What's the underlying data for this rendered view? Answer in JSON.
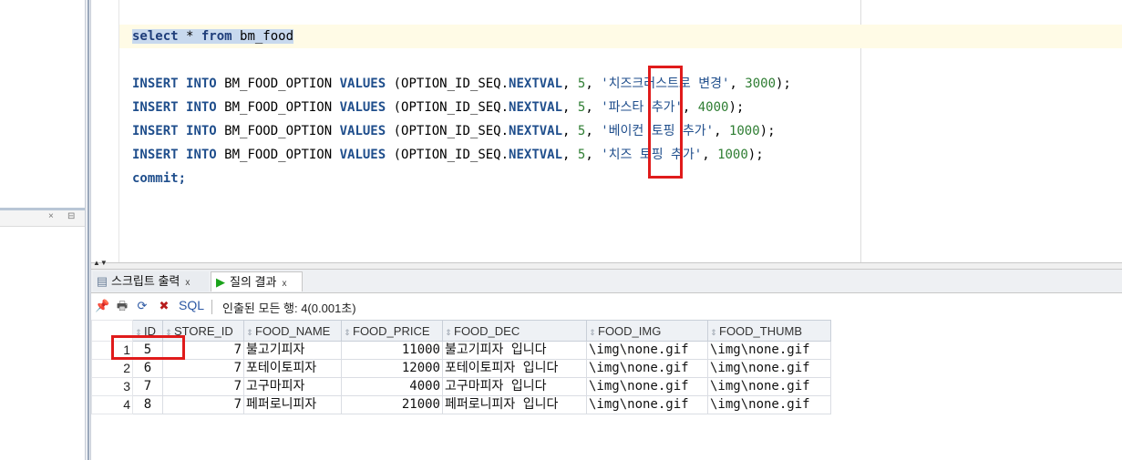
{
  "editor": {
    "select_line": [
      "select",
      " * ",
      "from",
      " bm_food"
    ],
    "insert_rows": [
      {
        "kw1": "INSERT",
        "kw2": "INTO",
        "table": " BM_FOOD_OPTION ",
        "kw3": "VALUES",
        "open": " (OPTION_ID_SEQ.",
        "nextval": "NEXTVAL",
        "sep": ", ",
        "id": "5",
        "comma": ", ",
        "str": "'치즈크러스트로 변경'",
        "sep2": ", ",
        "price": "3000",
        "end": ");"
      },
      {
        "kw1": "INSERT",
        "kw2": "INTO",
        "table": " BM_FOOD_OPTION ",
        "kw3": "VALUES",
        "open": " (OPTION_ID_SEQ.",
        "nextval": "NEXTVAL",
        "sep": ", ",
        "id": "5",
        "comma": ", ",
        "str": "'파스타 추가'",
        "sep2": ", ",
        "price": "4000",
        "end": ");"
      },
      {
        "kw1": "INSERT",
        "kw2": "INTO",
        "table": " BM_FOOD_OPTION ",
        "kw3": "VALUES",
        "open": " (OPTION_ID_SEQ.",
        "nextval": "NEXTVAL",
        "sep": ", ",
        "id": "5",
        "comma": ", ",
        "str": "'베이컨 토핑 추가'",
        "sep2": ", ",
        "price": "1000",
        "end": ");"
      },
      {
        "kw1": "INSERT",
        "kw2": "INTO",
        "table": " BM_FOOD_OPTION ",
        "kw3": "VALUES",
        "open": " (OPTION_ID_SEQ.",
        "nextval": "NEXTVAL",
        "sep": ", ",
        "id": "5",
        "comma": ", ",
        "str": "'치즈 토핑 추가'",
        "sep2": ", ",
        "price": "1000",
        "end": ");"
      }
    ],
    "commit_line": "commit;"
  },
  "tabs": [
    {
      "label": "스크립트 출력",
      "close": "x"
    },
    {
      "label": "질의 결과",
      "close": "x"
    }
  ],
  "results_toolbar": {
    "sql_label": "SQL",
    "status": "인출된 모든 행: 4(0.001초)"
  },
  "left_panel": {
    "close": "×",
    "minimize": "⊟"
  },
  "grid": {
    "columns": [
      "ID",
      "STORE_ID",
      "FOOD_NAME",
      "FOOD_PRICE",
      "FOOD_DEC",
      "FOOD_IMG",
      "FOOD_THUMB"
    ],
    "rows": [
      {
        "n": "1",
        "id": "5",
        "store_id": "7",
        "name": "불고기피자",
        "price": "11000",
        "dec": "불고기피자 입니다",
        "img": "\\img\\none.gif",
        "thumb": "\\img\\none.gif"
      },
      {
        "n": "2",
        "id": "6",
        "store_id": "7",
        "name": "포테이토피자",
        "price": "12000",
        "dec": "포테이토피자 입니다",
        "img": "\\img\\none.gif",
        "thumb": "\\img\\none.gif"
      },
      {
        "n": "3",
        "id": "7",
        "store_id": "7",
        "name": "고구마피자",
        "price": "4000",
        "dec": "고구마피자 입니다",
        "img": "\\img\\none.gif",
        "thumb": "\\img\\none.gif"
      },
      {
        "n": "4",
        "id": "8",
        "store_id": "7",
        "name": "페퍼로니피자",
        "price": "21000",
        "dec": "페퍼로니피자 입니다",
        "img": "\\img\\none.gif",
        "thumb": "\\img\\none.gif"
      }
    ]
  },
  "colors": {
    "highlight_box": "#e01b1b",
    "keyword": "#1f4e8c",
    "number": "#2e7d32"
  }
}
